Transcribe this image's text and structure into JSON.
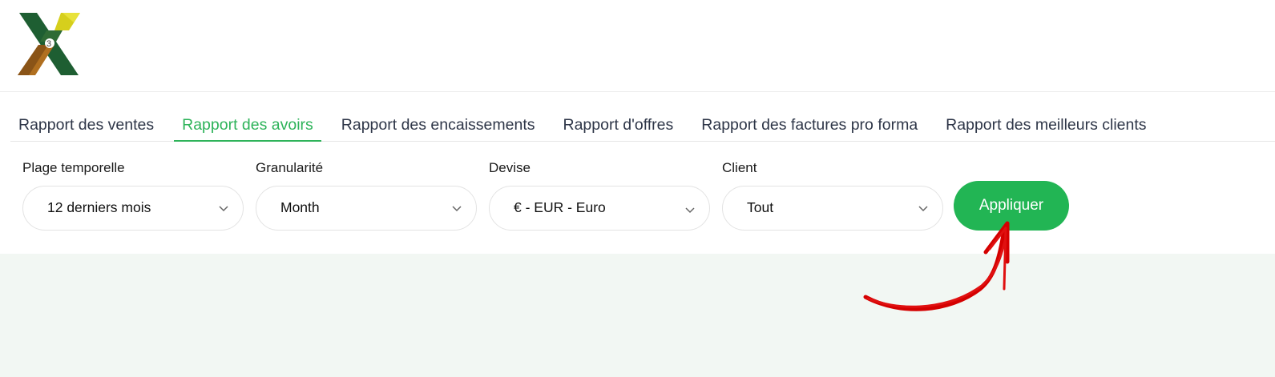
{
  "app": {
    "logo_icon": "x-logo-icon",
    "colors": {
      "accent": "#22b554",
      "active_tab": "#2eb35a",
      "tab_text": "#2e3648",
      "content_bg": "#f2f7f3",
      "annotation": "#d40000"
    }
  },
  "tabs": [
    {
      "label": "Rapport des ventes",
      "active": false
    },
    {
      "label": "Rapport des avoirs",
      "active": true
    },
    {
      "label": "Rapport des encaissements",
      "active": false
    },
    {
      "label": "Rapport d'offres",
      "active": false
    },
    {
      "label": "Rapport des factures pro forma",
      "active": false
    },
    {
      "label": "Rapport des meilleurs clients",
      "active": false
    }
  ],
  "filters": {
    "time_range": {
      "label": "Plage temporelle",
      "value": "12 derniers mois",
      "icon": "chevron-down-icon"
    },
    "granularity": {
      "label": "Granularité",
      "value": "Month",
      "icon": "chevron-down-icon"
    },
    "currency": {
      "label": "Devise",
      "value": "€ - EUR - Euro",
      "icon": "chevron-down-icon"
    },
    "client": {
      "label": "Client",
      "value": "Tout",
      "icon": "chevron-down-icon"
    }
  },
  "apply_button": {
    "label": "Appliquer"
  },
  "annotation": {
    "icon": "red-arrow-icon"
  }
}
